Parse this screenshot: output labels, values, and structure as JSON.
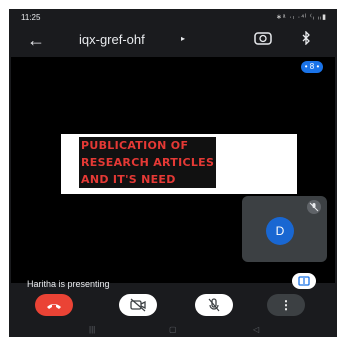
{
  "status_bar": {
    "time": "11:25",
    "icons_text": "∗ᵃ ·ₗ ·⁴ˡ ⁽ᵢ ᵢᵢ▮"
  },
  "header": {
    "back_icon": "arrow-left-icon",
    "meeting_code": "iqx-gref-ohf",
    "caret": "▸",
    "camera_switch_icon": "camera-switch-icon",
    "bluetooth_icon": "bluetooth-icon"
  },
  "participants_badge": "• 8 •",
  "slide": {
    "lines": [
      "PUBLICATION OF",
      "RESEARCH  ARTICLES",
      "AND IT'S NEED"
    ]
  },
  "self_tile": {
    "avatar_letter": "D",
    "mic_icon": "mic-off-icon"
  },
  "presenting_label": "Haritha is presenting",
  "controls": {
    "hangup_icon": "phone-hangup-icon",
    "camera_icon": "camera-off-icon",
    "mic_icon": "mic-off-icon",
    "more_label": "⋮"
  },
  "colors": {
    "hangup": "#ea4335",
    "avatar": "#1967d2",
    "badge": "#1a73e8",
    "slide_text": "#e53935"
  }
}
